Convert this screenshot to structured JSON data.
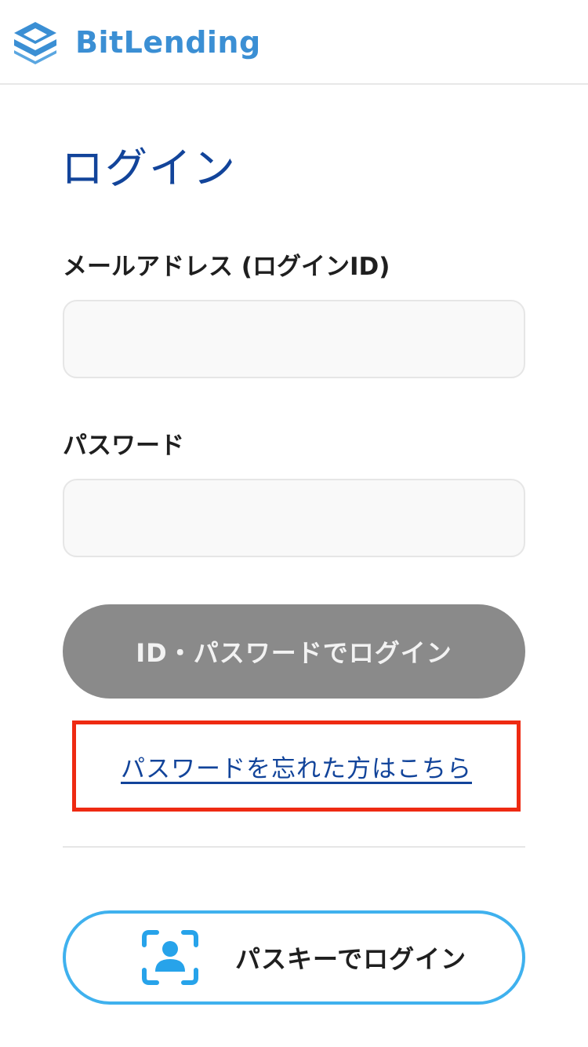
{
  "header": {
    "logo_icon": "stacked-layers-logo-icon",
    "brand_name": "BitLending"
  },
  "login": {
    "title": "ログイン",
    "email_label": "メールアドレス (ログインID)",
    "email_value": "",
    "password_label": "パスワード",
    "password_value": "",
    "submit_label": "ID・パスワードでログイン",
    "forgot_label": "パスワードを忘れた方はこちら",
    "passkey_icon": "face-id-person-icon",
    "passkey_label": "パスキーでログイン"
  },
  "colors": {
    "brand_blue": "#3b8fd4",
    "title_blue": "#12449a",
    "disabled_button": "#8a8a8a",
    "highlight_red": "#ee2a12",
    "passkey_border": "#3fb1ee"
  }
}
